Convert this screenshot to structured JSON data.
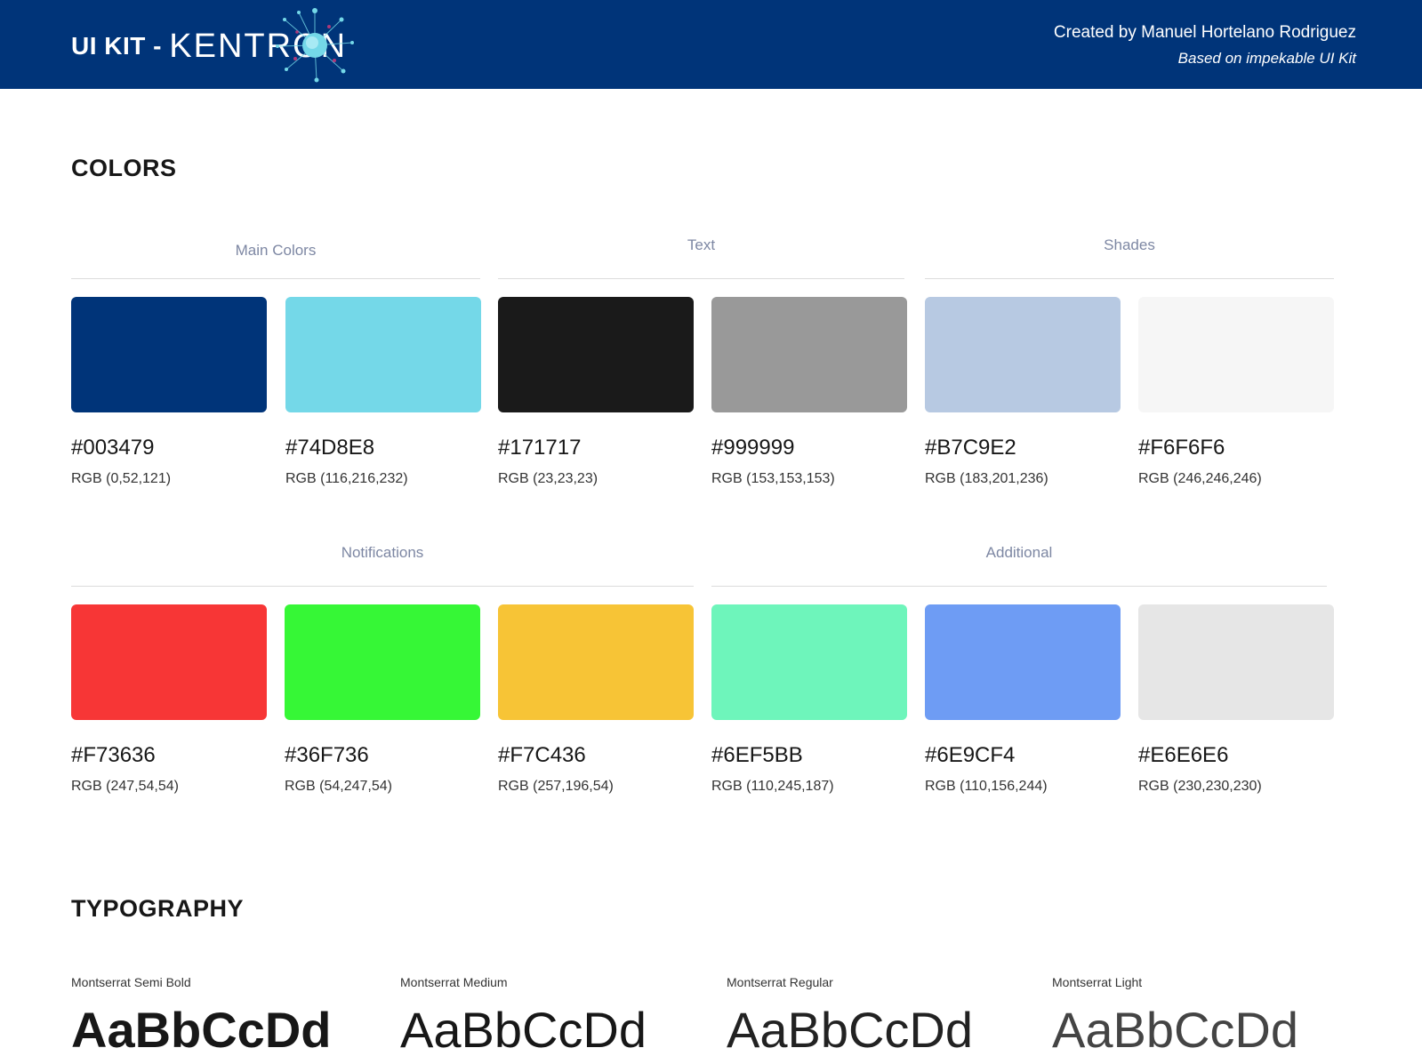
{
  "header": {
    "brand_prefix": "UI KIT -",
    "brand_name": "KENTRON",
    "credit_line1": "Created by Manuel Hortelano Rodriguez",
    "credit_line2": "Based on impekable UI Kit",
    "background": "#003479"
  },
  "colors_section": {
    "title": "COLORS",
    "groups_row1": [
      "Main Colors",
      "Text",
      "Shades"
    ],
    "groups_row2": [
      "Notifications",
      "Additional"
    ],
    "swatches": [
      {
        "hex": "#003479",
        "rgb": "RGB (0,52,121)"
      },
      {
        "hex": "#74D8E8",
        "rgb": "RGB (116,216,232)"
      },
      {
        "hex": "#171717",
        "rgb": "RGB (23,23,23)"
      },
      {
        "hex": "#999999",
        "rgb": "RGB (153,153,153)"
      },
      {
        "hex": "#B7C9E2",
        "rgb": "RGB (183,201,236)"
      },
      {
        "hex": "#F6F6F6",
        "rgb": "RGB (246,246,246)"
      },
      {
        "hex": "#F73636",
        "rgb": "RGB (247,54,54)"
      },
      {
        "hex": "#36F736",
        "rgb": "RGB (54,247,54)"
      },
      {
        "hex": "#F7C436",
        "rgb": "RGB (257,196,54)"
      },
      {
        "hex": "#6EF5BB",
        "rgb": "RGB (110,245,187)"
      },
      {
        "hex": "#6E9CF4",
        "rgb": "RGB (110,156,244)"
      },
      {
        "hex": "#E6E6E6",
        "rgb": "RGB (230,230,230)"
      }
    ]
  },
  "typography_section": {
    "title": "TYPOGRAPHY",
    "fonts": [
      {
        "name": "Montserrat Semi Bold",
        "sample": "AaBbCcDd"
      },
      {
        "name": "Montserrat Medium",
        "sample": "AaBbCcDd"
      },
      {
        "name": "Montserrat Regular",
        "sample": "AaBbCcDd"
      },
      {
        "name": "Montserrat Light",
        "sample": "AaBbCcDd"
      }
    ]
  }
}
